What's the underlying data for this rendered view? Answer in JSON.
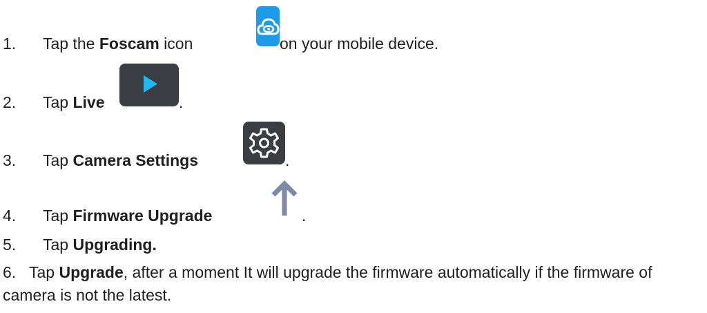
{
  "steps": [
    {
      "num": "1.",
      "pre": "Tap the ",
      "bold": "Foscam",
      "post": " icon",
      "after_icon": " on your mobile device.",
      "icon": "foscam-cloud-icon"
    },
    {
      "num": "2.",
      "pre": "Tap ",
      "bold": "Live",
      "post": "",
      "after_icon": ".",
      "icon": "play-icon"
    },
    {
      "num": "3.",
      "pre": "Tap ",
      "bold": "Camera Settings",
      "post": "",
      "after_icon": ".",
      "icon": "gear-icon"
    },
    {
      "num": "4.",
      "pre": "Tap ",
      "bold": "Firmware Upgrade",
      "post": "",
      "after_icon": ".",
      "icon": "up-arrow-icon"
    },
    {
      "num": "5.",
      "pre": "Tap ",
      "bold": "Upgrading.",
      "post": ""
    },
    {
      "num": "6.",
      "pre": "Tap ",
      "bold": "Upgrade",
      "post": ", after a moment It will upgrade the firmware automatically if the firmware of camera is not the latest."
    }
  ],
  "colors": {
    "foscam_icon": "#1e9be8",
    "play_icon_bg": "#3a3d42",
    "play_triangle": "#21b8f0",
    "gear_icon_bg": "#3a3d42",
    "arrow_icon": "#7d8aa6"
  }
}
